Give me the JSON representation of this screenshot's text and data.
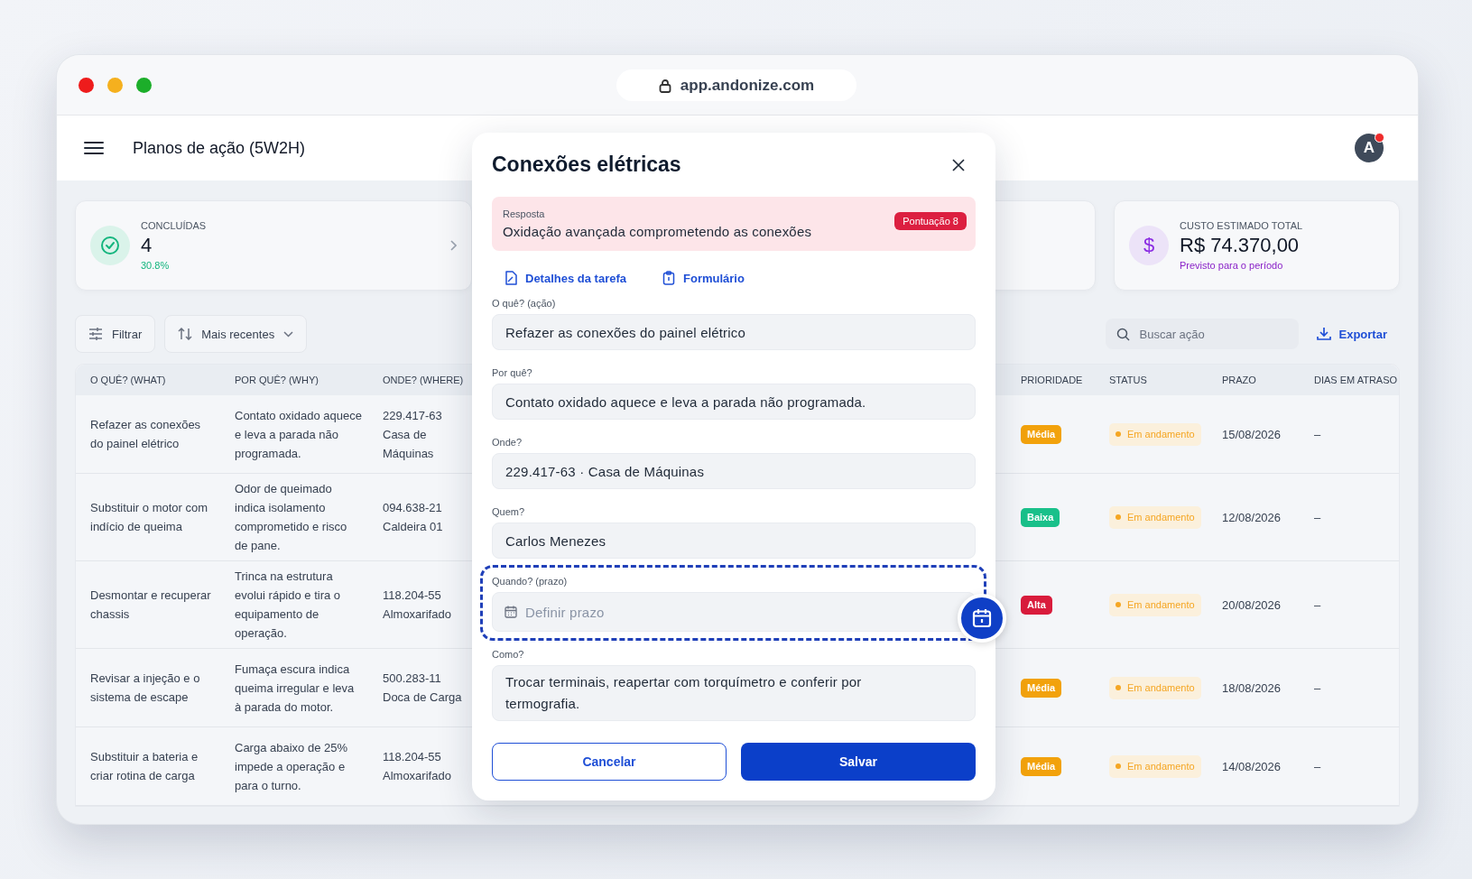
{
  "browser": {
    "url": "app.andonize.com"
  },
  "header": {
    "title": "Planos de ação (5W2H)",
    "avatar": "A",
    "notification": true
  },
  "stats": [
    {
      "kind": "done",
      "label": "CONCLUÍDAS",
      "value": "4",
      "note": "30.8%"
    },
    {
      "kind": "cost",
      "icon": "$",
      "label": "CUSTO ESTIMADO TOTAL",
      "value": "R$ 74.370,00",
      "note": "Previsto para o período"
    }
  ],
  "toolbar": {
    "filter": "Filtrar",
    "sort": "Mais recentes",
    "search_placeholder": "Buscar ação",
    "export": "Exportar"
  },
  "table": {
    "columns": [
      "O QUÊ? (WHAT)",
      "POR QUÊ? (WHY)",
      "ONDE? (WHERE)",
      "PRIORIDADE",
      "STATUS",
      "PRAZO",
      "DIAS EM ATRASO"
    ],
    "rows": [
      {
        "what": "Refazer as conexões do painel elétrico",
        "why": "Contato oxidado aquece e leva a parada não programada.",
        "where": [
          "229.417-63",
          "Casa de Máquinas"
        ],
        "priority": {
          "label": "Média",
          "color": "#f2a20c"
        },
        "status": {
          "label": "Em andamento",
          "color": "#f5a623"
        },
        "deadline": "15/08/2026",
        "delay": "–"
      },
      {
        "what": "Substituir o motor com indício de queima",
        "why": "Odor de queimado indica isolamento comprometido e risco de pane.",
        "where": [
          "094.638-21",
          "Caldeira 01"
        ],
        "priority": {
          "label": "Baixa",
          "color": "#19c08a"
        },
        "status": {
          "label": "Em andamento",
          "color": "#f5a623"
        },
        "deadline": "12/08/2026",
        "delay": "–"
      },
      {
        "what": "Desmontar e recuperar chassis",
        "why": "Trinca na estrutura evolui rápido e tira o equipamento de operação.",
        "where": [
          "118.204-55",
          "Almoxarifado"
        ],
        "priority": {
          "label": "Alta",
          "color": "#d91c3c"
        },
        "status": {
          "label": "Em andamento",
          "color": "#f5a623"
        },
        "deadline": "20/08/2026",
        "delay": "–"
      },
      {
        "what": "Revisar a injeção e o sistema de escape",
        "why": "Fumaça escura indica queima irregular e leva à parada do motor.",
        "where": [
          "500.283-11",
          "Doca de Carga"
        ],
        "priority": {
          "label": "Média",
          "color": "#f2a20c"
        },
        "status": {
          "label": "Em andamento",
          "color": "#f5a623"
        },
        "deadline": "18/08/2026",
        "delay": "–"
      },
      {
        "what": "Substituir a bateria e criar rotina de carga",
        "why": "Carga abaixo de 25% impede a operação e para o turno.",
        "where": [
          "118.204-55",
          "Almoxarifado"
        ],
        "priority": {
          "label": "Média",
          "color": "#f2a20c"
        },
        "status": {
          "label": "Em andamento",
          "color": "#f5a623"
        },
        "deadline": "14/08/2026",
        "delay": "–"
      }
    ]
  },
  "modal": {
    "title": "Conexões elétricas",
    "response": {
      "label": "Resposta",
      "text": "Oxidação avançada comprometendo as conexões",
      "badge": "Pontuação 8"
    },
    "links": [
      {
        "kind": "details",
        "label": "Detalhes da tarefa"
      },
      {
        "kind": "form",
        "label": "Formulário"
      }
    ],
    "fields": [
      {
        "kind": "text",
        "label": "O quê? (ação)",
        "value": "Refazer as conexões do painel elétrico",
        "highlighted": false
      },
      {
        "kind": "text",
        "label": "Por quê?",
        "value": "Contato oxidado aquece e leva a parada não programada.",
        "highlighted": false
      },
      {
        "kind": "text",
        "label": "Onde?",
        "value": "229.417-63 · Casa de Máquinas",
        "highlighted": false
      },
      {
        "kind": "text",
        "label": "Quem?",
        "value": "Carlos Menezes",
        "highlighted": false
      },
      {
        "kind": "date",
        "label": "Quando? (prazo)",
        "placeholder": "Definir prazo",
        "highlighted": true
      },
      {
        "kind": "textarea",
        "label": "Como?",
        "value": "Trocar terminais, reapertar com torquímetro e conferir por termografia.",
        "highlighted": false
      }
    ],
    "buttons": [
      {
        "kind": "secondary",
        "label": "Cancelar"
      },
      {
        "kind": "primary",
        "label": "Salvar"
      }
    ]
  }
}
